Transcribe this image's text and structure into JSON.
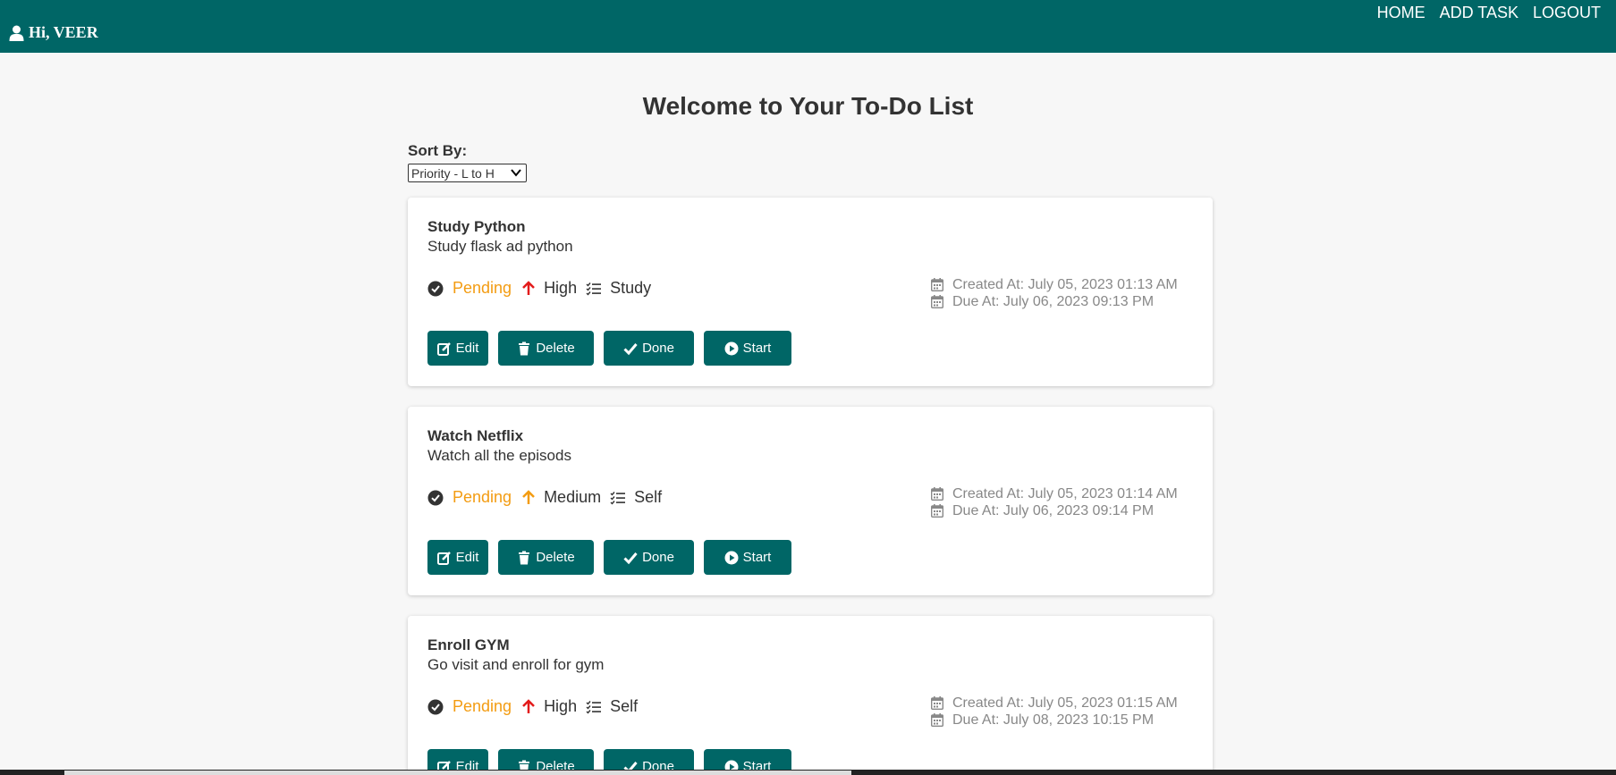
{
  "header": {
    "greeting": "Hi, VEER",
    "nav": [
      "HOME",
      "ADD TASK",
      "LOGOUT"
    ]
  },
  "page": {
    "title": "Welcome to Your To-Do List",
    "sort_label": "Sort By:",
    "sort_value": "Priority - L to H"
  },
  "tasks": [
    {
      "title": "Study Python",
      "description": "Study flask ad python",
      "status": "Pending",
      "priority": "High",
      "category": "Study",
      "created": "Created At: July 05, 2023 01:13 AM",
      "due": "Due At: July 06, 2023 09:13 PM"
    },
    {
      "title": "Watch Netflix",
      "description": "Watch all the episods",
      "status": "Pending",
      "priority": "Medium",
      "category": "Self",
      "created": "Created At: July 05, 2023 01:14 AM",
      "due": "Due At: July 06, 2023 09:14 PM"
    },
    {
      "title": "Enroll GYM",
      "description": "Go visit and enroll for gym",
      "status": "Pending",
      "priority": "High",
      "category": "Self",
      "created": "Created At: July 05, 2023 01:15 AM",
      "due": "Due At: July 08, 2023 10:15 PM"
    }
  ],
  "buttons": {
    "edit": "Edit",
    "delete": "Delete",
    "done": "Done",
    "start": "Start"
  },
  "colors": {
    "brand": "#006666",
    "pending": "#f39c12",
    "priority_high": "#e31b1b",
    "priority_medium": "#f39c12"
  }
}
